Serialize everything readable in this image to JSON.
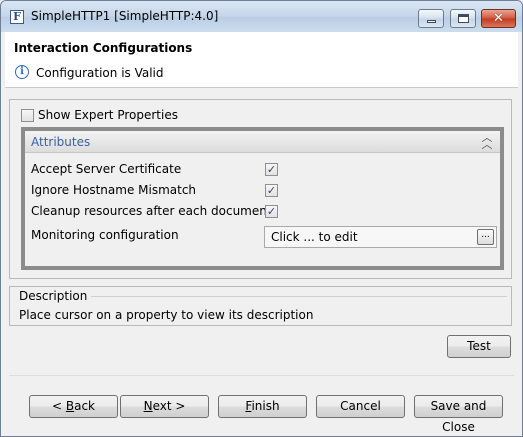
{
  "window": {
    "title": "SimpleHTTP1 [SimpleHTTP:4.0]",
    "app_icon_letter": "F",
    "controls": {
      "minimize": "minimize",
      "maximize": "maximize",
      "close": "✕"
    }
  },
  "header": {
    "title": "Interaction Configurations",
    "status_icon": "info-icon",
    "status_text": "Configuration is Valid"
  },
  "expert": {
    "label": "Show Expert Properties",
    "checked": false
  },
  "attributes": {
    "title": "Attributes",
    "collapse_icon": "double-chevron-up-icon",
    "properties": [
      {
        "label": "Accept Server Certificate",
        "checked": true
      },
      {
        "label": "Ignore Hostname Mismatch",
        "checked": true
      },
      {
        "label": "Cleanup resources after each document.",
        "checked": true
      }
    ],
    "monitoring": {
      "label": "Monitoring configuration",
      "value": "Click ... to edit",
      "button": "..."
    }
  },
  "description": {
    "title": "Description",
    "text": "Place cursor on a property to view its description"
  },
  "buttons": {
    "test": "Test",
    "back_mnemonic": "< ",
    "back_u": "B",
    "back_rest": "ack",
    "next_u": "N",
    "next_rest": "ext >",
    "finish_u": "F",
    "finish_rest": "inish",
    "cancel": "Cancel",
    "save_close": "Save and Close"
  }
}
